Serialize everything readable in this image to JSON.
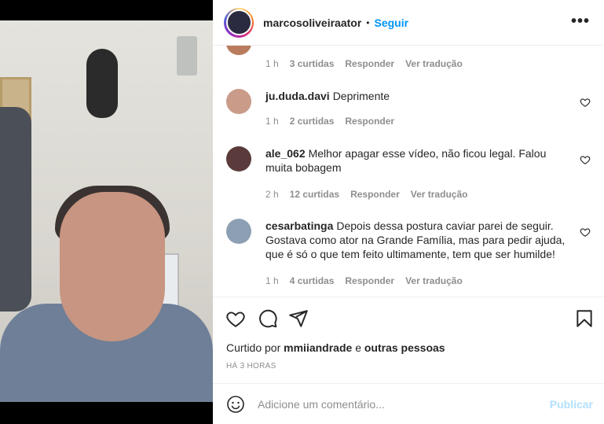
{
  "header": {
    "username": "marcosoliveiraator",
    "separator": "•",
    "follow_label": "Seguir",
    "more_label": "•••"
  },
  "comments_meta_top": {
    "time": "1 h",
    "likes": "3 curtidas",
    "reply": "Responder",
    "translate": "Ver tradução"
  },
  "comments": [
    {
      "user": "ju.duda.davi",
      "text": "Deprimente",
      "time": "1 h",
      "likes": "2 curtidas",
      "reply": "Responder",
      "translate": ""
    },
    {
      "user": "ale_062",
      "text": "Melhor apagar esse vídeo, não ficou legal. Falou muita bobagem",
      "time": "2 h",
      "likes": "12 curtidas",
      "reply": "Responder",
      "translate": "Ver tradução"
    },
    {
      "user": "cesarbatinga",
      "text": "Depois dessa postura caviar parei de seguir. Gostava como ator na Grande Família, mas para pedir ajuda, que é só o que tem feito ultimamente, tem que ser humilde!",
      "time": "1 h",
      "likes": "4 curtidas",
      "reply": "Responder",
      "translate": "Ver tradução"
    }
  ],
  "likes": {
    "prefix": "Curtido por",
    "user": "mmiiandrade",
    "conj": "e",
    "others": "outras pessoas"
  },
  "time_ago": "HÁ 3 HORAS",
  "add_comment": {
    "placeholder": "Adicione um comentário...",
    "publish_label": "Publicar"
  },
  "icons": {
    "like": "heart-icon",
    "comment": "comment-icon",
    "share": "share-icon",
    "save": "bookmark-icon",
    "emoji": "emoji-icon",
    "more": "more-icon"
  },
  "colors": {
    "accent": "#0095f6",
    "publish_disabled": "#b2dffc",
    "muted": "#8e8e8e",
    "text": "#262626"
  }
}
